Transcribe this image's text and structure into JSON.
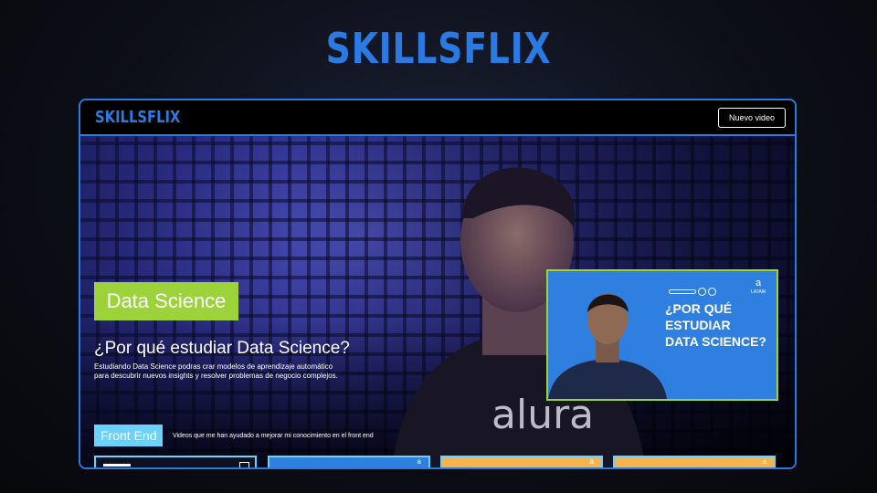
{
  "app": {
    "brand": "SKILLSFLIX"
  },
  "header": {
    "logo": "SKILLSFLIX",
    "new_video_label": "Nuevo video"
  },
  "hero": {
    "category": "Data Science",
    "title": "¿Por qué estudiar Data Science?",
    "description": "Estudiando Data Science podras crar modelos de aprendizaje automático para descubrir nuevos insights y resolver problemas de negocio complejos.",
    "thumbnail": {
      "title_line1": "¿POR QUÉ",
      "title_line2": "ESTUDIAR",
      "title_line3": "DATA SCIENCE?",
      "brand": "a",
      "brand_sub": "LATAM"
    }
  },
  "section": {
    "category": "Front End",
    "description": "Videos que me han ayudado a mejorar mi conocimiento en el front end"
  },
  "colors": {
    "accent": "#2a7ae4",
    "data_science": "#9cd33b",
    "front_end": "#6bd1ff"
  },
  "icons": [
    "alura-brand-icon"
  ]
}
